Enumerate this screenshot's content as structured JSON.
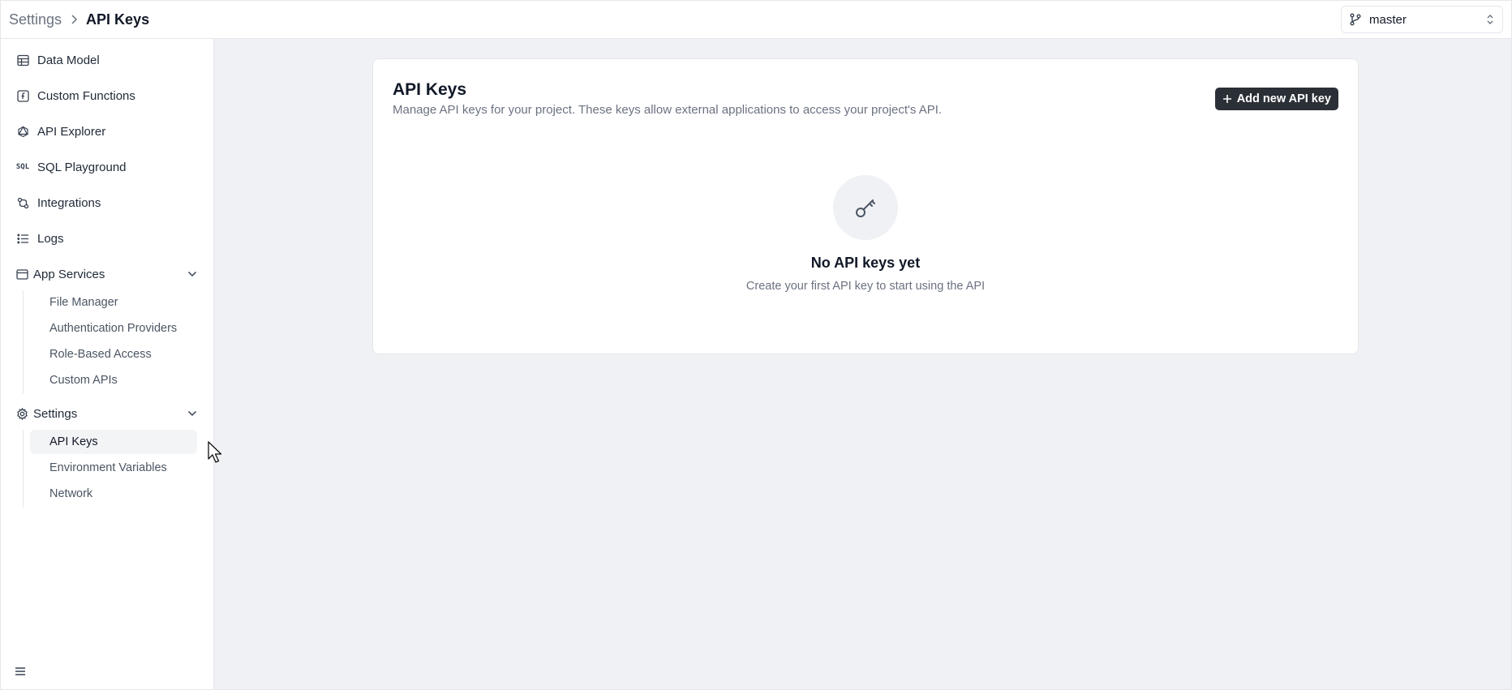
{
  "header": {
    "breadcrumb_parent": "Settings",
    "breadcrumb_current": "API Keys",
    "branch": "master"
  },
  "sidebar": {
    "items": [
      {
        "label": "Data Model",
        "icon": "table-icon"
      },
      {
        "label": "Custom Functions",
        "icon": "function-icon"
      },
      {
        "label": "API Explorer",
        "icon": "graphql-icon"
      },
      {
        "label": "SQL Playground",
        "icon": "sql-icon"
      },
      {
        "label": "Integrations",
        "icon": "integrations-icon"
      },
      {
        "label": "Logs",
        "icon": "list-icon"
      }
    ],
    "app_services": {
      "label": "App Services",
      "items": [
        "File Manager",
        "Authentication Providers",
        "Role-Based Access",
        "Custom APIs"
      ]
    },
    "settings": {
      "label": "Settings",
      "items": [
        "API Keys",
        "Environment Variables",
        "Network"
      ],
      "active": "API Keys"
    }
  },
  "main": {
    "title": "API Keys",
    "description": "Manage API keys for your project. These keys allow external applications to access your project's API.",
    "add_button": "Add new API key",
    "empty_title": "No API keys yet",
    "empty_subtitle": "Create your first API key to start using the API"
  }
}
